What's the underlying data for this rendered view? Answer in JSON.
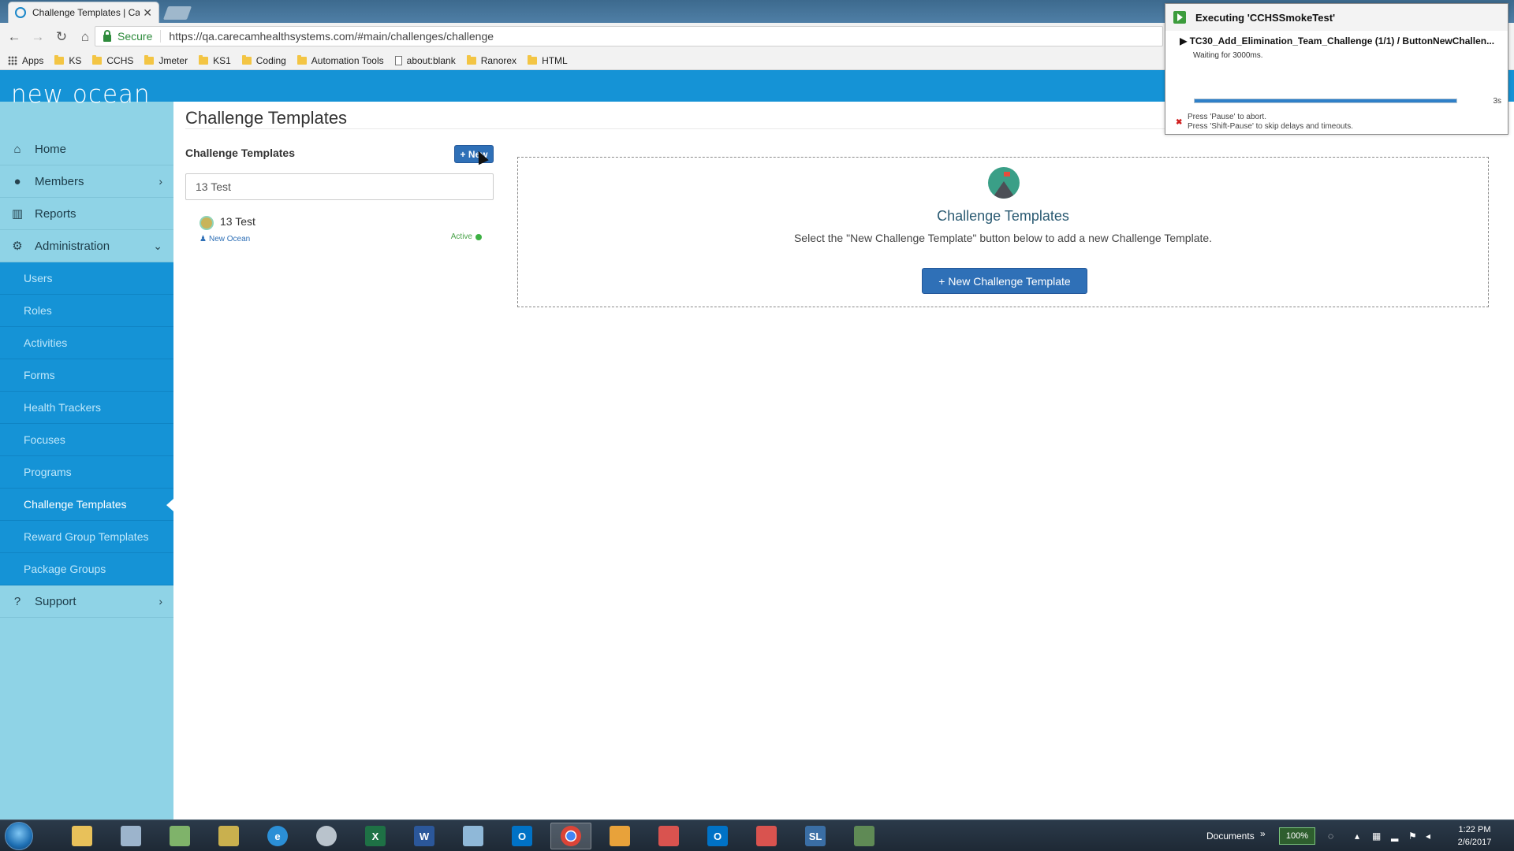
{
  "browser": {
    "tab_title": "Challenge Templates | Ca",
    "tab_close": "✕",
    "secure_label": "Secure",
    "url": "https://qa.carecamhealthsystems.com/#main/challenges/challenge",
    "bookmarks": [
      "Apps",
      "KS",
      "CCHS",
      "Jmeter",
      "KS1",
      "Coding",
      "Automation Tools",
      "about:blank",
      "Ranorex",
      "HTML"
    ]
  },
  "app": {
    "logo": "new ocean",
    "brand_color": "#1593d6"
  },
  "sidebar": {
    "items": [
      {
        "label": "Home",
        "icon": "home-icon"
      },
      {
        "label": "Members",
        "icon": "user-icon"
      },
      {
        "label": "Reports",
        "icon": "bar-chart-icon"
      },
      {
        "label": "Administration",
        "icon": "gear-icon"
      }
    ],
    "admin_items": [
      "Users",
      "Roles",
      "Activities",
      "Forms",
      "Health Trackers",
      "Focuses",
      "Programs",
      "Challenge Templates",
      "Reward Group Templates",
      "Package Groups"
    ],
    "support_label": "Support",
    "active_item": "Challenge Templates"
  },
  "main": {
    "page_title": "Challenge Templates",
    "list_title": "Challenge Templates",
    "new_button": "+ New",
    "search_value": "13 Test",
    "list_items": [
      {
        "name": "13 Test",
        "group": "New Ocean",
        "status": "Active"
      }
    ],
    "panel": {
      "title": "Challenge Templates",
      "text": "Select the \"New Challenge Template\" button below to add a new Challenge Template.",
      "button": "+ New Challenge Template"
    }
  },
  "ranorex": {
    "title": "Executing 'CCHSSmokeTest'",
    "case": "TC30_Add_Elimination_Team_Challenge (1/1) / ButtonNewChallen...",
    "waiting": "Waiting for 3000ms.",
    "progress_percent": 100,
    "time": "3s",
    "hint1": "Press 'Pause' to abort.",
    "hint2": "Press 'Shift-Pause' to skip delays and timeouts."
  },
  "taskbar": {
    "documents_label": "Documents",
    "battery": "100%",
    "time": "1:22 PM",
    "date": "2/6/2017"
  }
}
